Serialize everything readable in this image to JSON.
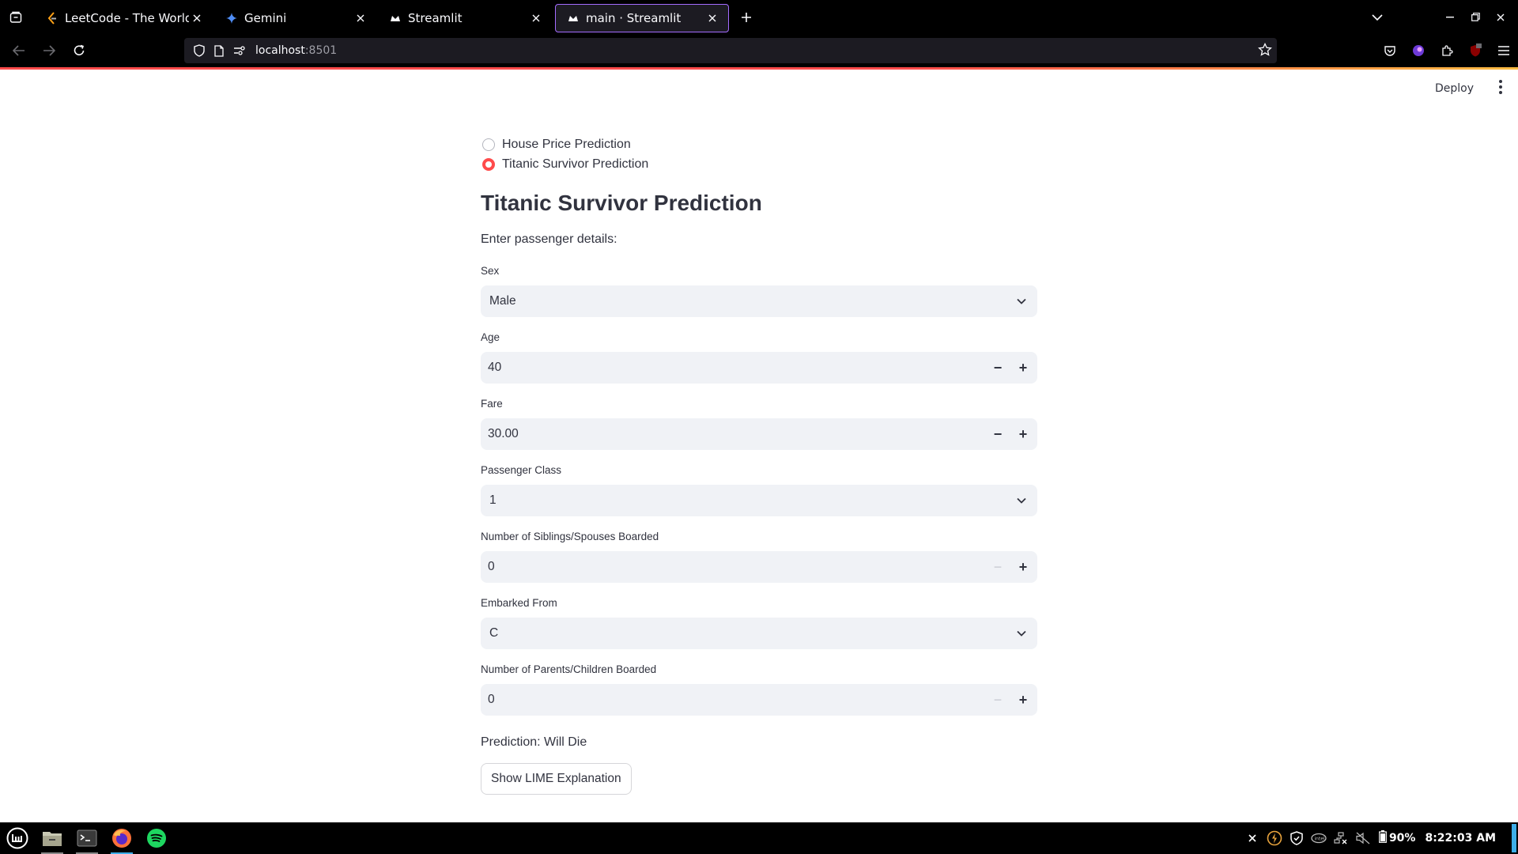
{
  "browser": {
    "tabs": [
      {
        "label": "LeetCode - The World's L",
        "icon": "leetcode-icon",
        "active": false
      },
      {
        "label": "Gemini",
        "icon": "gemini-icon",
        "active": false
      },
      {
        "label": "Streamlit",
        "icon": "streamlit-icon",
        "active": false
      },
      {
        "label": "main · Streamlit",
        "icon": "streamlit-icon",
        "active": true
      }
    ],
    "url": {
      "host": "localhost",
      "port": ":8501"
    }
  },
  "app": {
    "deploy_label": "Deploy",
    "mode_options": [
      "House Price Prediction",
      "Titanic Survivor Prediction"
    ],
    "selected_mode": "Titanic Survivor Prediction",
    "title": "Titanic Survivor Prediction",
    "intro": "Enter passenger details:",
    "fields": {
      "sex": {
        "label": "Sex",
        "value": "Male"
      },
      "age": {
        "label": "Age",
        "value": "40"
      },
      "fare": {
        "label": "Fare",
        "value": "30.00"
      },
      "pclass": {
        "label": "Passenger Class",
        "value": "1"
      },
      "sibsp": {
        "label": "Number of Siblings/Spouses Boarded",
        "value": "0"
      },
      "embarked": {
        "label": "Embarked From",
        "value": "C"
      },
      "parch": {
        "label": "Number of Parents/Children Boarded",
        "value": "0"
      }
    },
    "prediction": "Prediction: Will Die",
    "lime_button": "Show LIME Explanation"
  },
  "taskbar": {
    "battery": "90%",
    "clock": "8:22:03 AM"
  },
  "colors": {
    "accent": "#ff4b4b",
    "input_bg": "#f0f2f6",
    "text": "#31333f"
  }
}
